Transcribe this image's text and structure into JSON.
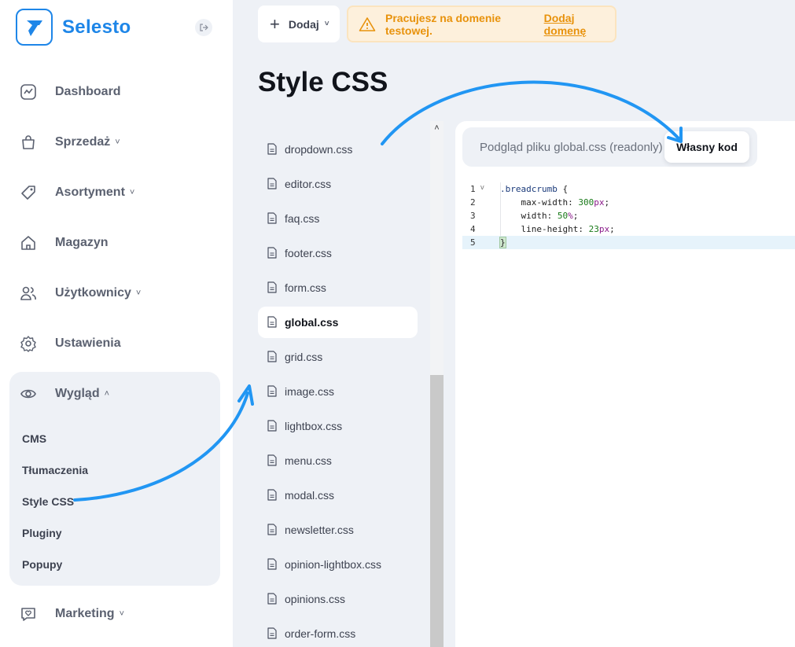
{
  "brand": {
    "name": "Selesto",
    "accent": "#1e86e8"
  },
  "sidebar": {
    "items": [
      {
        "label": "Dashboard",
        "icon": "chart-line-icon"
      },
      {
        "label": "Sprzedaż",
        "icon": "bag-icon"
      },
      {
        "label": "Asortyment",
        "icon": "tag-icon"
      },
      {
        "label": "Magazyn",
        "icon": "home-icon"
      },
      {
        "label": "Użytkownicy",
        "icon": "users-icon"
      },
      {
        "label": "Ustawienia",
        "icon": "gear-icon"
      },
      {
        "label": "Wygląd",
        "icon": "eye-icon"
      },
      {
        "label": "Marketing",
        "icon": "heart-chat-icon"
      }
    ],
    "wyglad_sub": [
      "CMS",
      "Tłumaczenia",
      "Style CSS",
      "Pluginy",
      "Popupy"
    ]
  },
  "topbar": {
    "add_label": "Dodaj",
    "warning_text": "Pracujesz na domenie testowej.",
    "warning_link": "Dodaj domenę",
    "warning_color": "#e8920c"
  },
  "page": {
    "title": "Style CSS"
  },
  "files": [
    "dropdown.css",
    "editor.css",
    "faq.css",
    "footer.css",
    "form.css",
    "global.css",
    "grid.css",
    "image.css",
    "lightbox.css",
    "menu.css",
    "modal.css",
    "newsletter.css",
    "opinion-lightbox.css",
    "opinions.css",
    "order-form.css"
  ],
  "active_file": "global.css",
  "editor": {
    "tab_readonly": "Podgląd pliku global.css (readonly)",
    "tab_custom": "Własny kod",
    "line_numbers": [
      "1",
      "2",
      "3",
      "4",
      "5"
    ],
    "selector": ".breadcrumb",
    "open_brace": "{",
    "close_brace": "}",
    "declarations": [
      {
        "prop": "max-width: ",
        "num": "300",
        "unit": "px",
        "end": ";"
      },
      {
        "prop": "width: ",
        "num": "50",
        "unit": "%",
        "end": ";"
      },
      {
        "prop": "line-height: ",
        "num": "23",
        "unit": "px",
        "end": ";"
      }
    ]
  }
}
